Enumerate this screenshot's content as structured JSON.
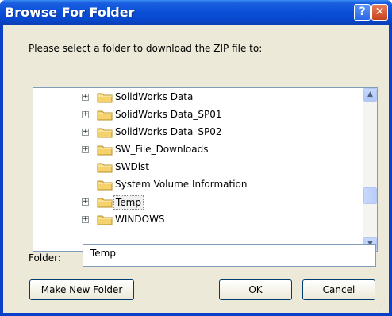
{
  "window": {
    "title": "Browse For Folder",
    "help_label": "?",
    "close_label": "✕"
  },
  "prompt": "Please select a folder to download the ZIP file to:",
  "tree": {
    "items": [
      {
        "label": "SolidWorks Data",
        "expandable": true,
        "selected": false
      },
      {
        "label": "SolidWorks Data_SP01",
        "expandable": true,
        "selected": false
      },
      {
        "label": "SolidWorks Data_SP02",
        "expandable": true,
        "selected": false
      },
      {
        "label": "SW_File_Downloads",
        "expandable": true,
        "selected": false
      },
      {
        "label": "SWDist",
        "expandable": false,
        "selected": false
      },
      {
        "label": "System Volume Information",
        "expandable": false,
        "selected": false
      },
      {
        "label": "Temp",
        "expandable": true,
        "selected": true
      },
      {
        "label": "WINDOWS",
        "expandable": true,
        "selected": false
      }
    ],
    "expander_glyph": "+",
    "scroll_up_glyph": "▲",
    "scroll_down_glyph": "▼"
  },
  "folder": {
    "label": "Folder:",
    "value": "Temp"
  },
  "buttons": {
    "make_new_folder": "Make New Folder",
    "ok": "OK",
    "cancel": "Cancel"
  },
  "colors": {
    "titlebar": "#0a4fd8",
    "dialog_bg": "#ece9d8",
    "folder_icon": "#f5d26b"
  }
}
